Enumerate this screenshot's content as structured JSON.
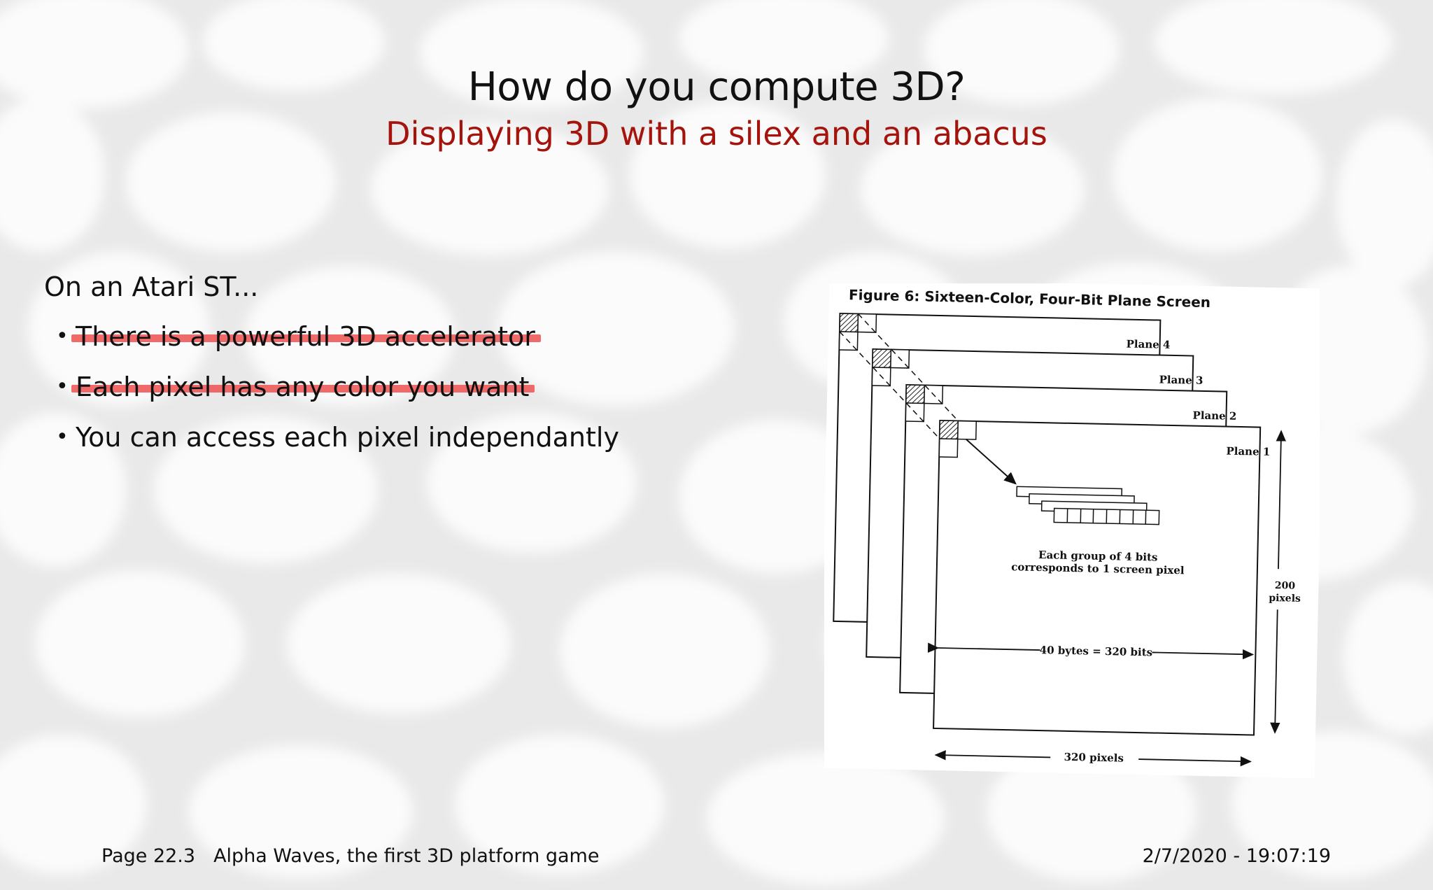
{
  "slide": {
    "title": "How do you compute 3D?",
    "subtitle": "Displaying 3D with a silex and an abacus",
    "intro": "On an Atari ST...",
    "bullets": [
      {
        "text": "There is a powerful 3D accelerator",
        "struck": true
      },
      {
        "text": "Each pixel has any color you want",
        "struck": true
      },
      {
        "text": "You can access each pixel independantly",
        "struck": false
      }
    ]
  },
  "figure": {
    "caption": "Figure 6: Sixteen-Color, Four-Bit Plane Screen",
    "planes": [
      "Plane 4",
      "Plane 3",
      "Plane 2",
      "Plane 1"
    ],
    "group_label_1": "Each group of 4 bits",
    "group_label_2": "corresponds to 1 screen pixel",
    "width_label": "40 bytes = 320 bits",
    "height_label_1": "200",
    "height_label_2": "pixels",
    "bottom_label": "320 pixels"
  },
  "footer": {
    "page": "Page 22.3",
    "doc_title": "Alpha Waves, the first 3D platform game",
    "timestamp": "2/7/2020 - 19:07:19"
  },
  "colors": {
    "accent": "#a5140c",
    "strike": "#ee5a5a"
  }
}
